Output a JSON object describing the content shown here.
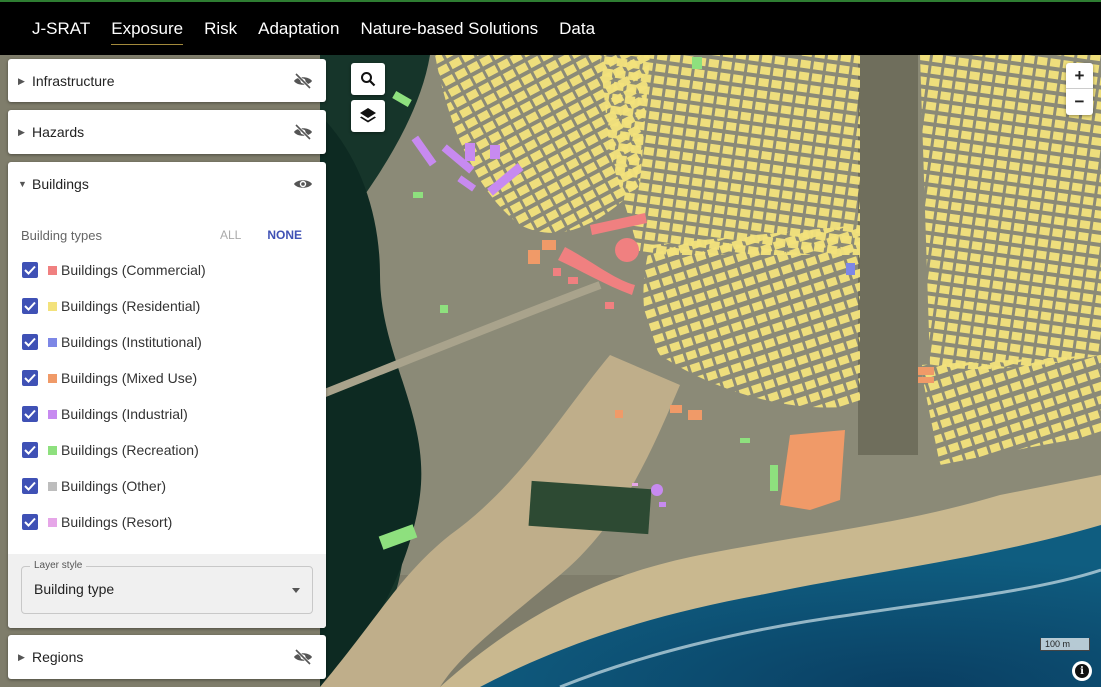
{
  "nav": {
    "brand": "J-SRAT",
    "items": [
      "Exposure",
      "Risk",
      "Adaptation",
      "Nature-based Solutions",
      "Data"
    ],
    "active": "Exposure"
  },
  "panels": {
    "infrastructure": {
      "title": "Infrastructure",
      "visibility_icon": "eye-off-icon"
    },
    "hazards": {
      "title": "Hazards",
      "visibility_icon": "eye-off-icon"
    },
    "buildings": {
      "title": "Buildings",
      "visibility_icon": "eye-icon",
      "types_label": "Building types",
      "all_label": "ALL",
      "none_label": "NONE",
      "types": [
        {
          "label": "Buildings (Commercial)",
          "color": "#f08080",
          "checked": true
        },
        {
          "label": "Buildings (Residential)",
          "color": "#f3e27c",
          "checked": true
        },
        {
          "label": "Buildings (Institutional)",
          "color": "#7d87e6",
          "checked": true
        },
        {
          "label": "Buildings (Mixed Use)",
          "color": "#f09a68",
          "checked": true
        },
        {
          "label": "Buildings (Industrial)",
          "color": "#c78af0",
          "checked": true
        },
        {
          "label": "Buildings (Recreation)",
          "color": "#8ee07e",
          "checked": true
        },
        {
          "label": "Buildings (Other)",
          "color": "#bdbdbd",
          "checked": true
        },
        {
          "label": "Buildings (Resort)",
          "color": "#e6a6e8",
          "checked": true
        }
      ],
      "style_legend": "Layer style",
      "style_value": "Building type"
    },
    "regions": {
      "title": "Regions",
      "visibility_icon": "eye-off-icon"
    }
  },
  "map": {
    "search_icon": "search-icon",
    "layers_icon": "layers-icon",
    "zoom_in": "+",
    "zoom_out": "−",
    "scale_label": "100 m",
    "info_icon": "i"
  },
  "colors": {
    "accent": "#3f51b5",
    "topbar_border": "#2e7d32",
    "sea": "#0f4f73"
  }
}
